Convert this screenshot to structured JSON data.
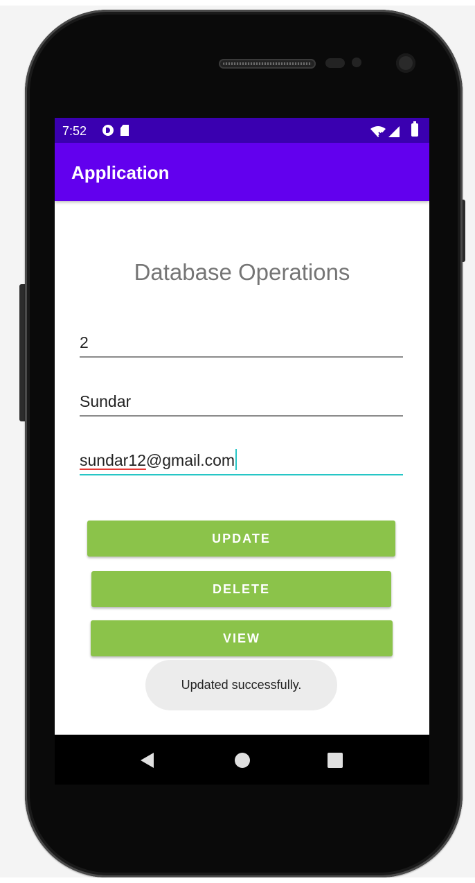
{
  "status_bar": {
    "time": "7:52",
    "icons": [
      "app-notification-icon",
      "sd-card-icon",
      "wifi-icon",
      "signal-icon",
      "battery-icon"
    ]
  },
  "app_bar": {
    "title": "Application"
  },
  "main": {
    "heading": "Database Operations",
    "fields": {
      "id_value": "2",
      "name_value": "Sundar",
      "email_misspelled_part": "sundar12",
      "email_rest": "@gmail.com"
    },
    "buttons": {
      "update": "UPDATE",
      "delete": "DELETE",
      "view": "VIEW"
    }
  },
  "toast": {
    "message": "Updated successfully."
  },
  "nav_bar": {
    "icons": [
      "back-icon",
      "home-icon",
      "recents-icon"
    ]
  },
  "colors": {
    "status_bar": "#3a00b0",
    "app_bar": "#6200ee",
    "button": "#8bc34a",
    "active_field": "#26c6c6",
    "spellcheck": "#e53935"
  }
}
